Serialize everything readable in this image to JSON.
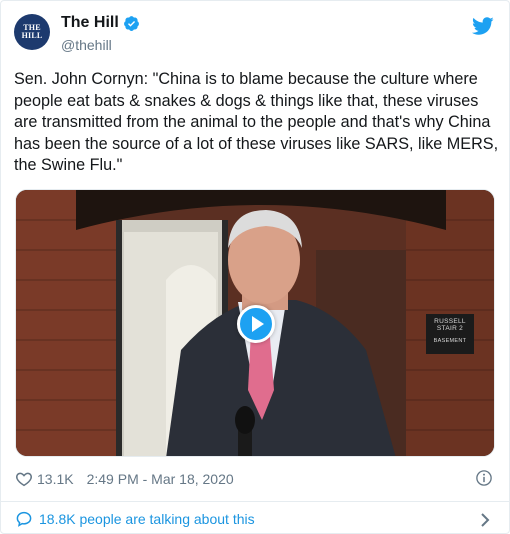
{
  "author": {
    "name": "The Hill",
    "handle": "@thehill",
    "avatar_text": [
      "THE",
      "HILL"
    ],
    "verified": true,
    "avatar_color": "#1d3a6e"
  },
  "tweet": {
    "text": "Sen. John Cornyn: \"China is to blame because the culture where people eat bats & snakes & dogs & things like that, these viruses are transmitted from the animal to the people and that's why China has been the source of a lot of these viruses like SARS, like MERS, the Swine Flu.\""
  },
  "media": {
    "type": "video",
    "sign_lines": [
      "RUSSELL",
      "STAIR 2",
      "BASEMENT"
    ],
    "play_icon": "play-icon"
  },
  "footer": {
    "likes": "13.1K",
    "timestamp": "2:49 PM - Mar 18, 2020",
    "talking": "18.8K people are talking about this"
  },
  "icons": {
    "like": "heart-icon",
    "info": "info-icon",
    "talking": "speech-bubble-icon",
    "more": "chevron-right-icon",
    "brand": "twitter-bird-icon"
  },
  "colors": {
    "accent": "#1da1f2",
    "link": "#1b95e0",
    "muted": "#657786",
    "text": "#14171a"
  }
}
